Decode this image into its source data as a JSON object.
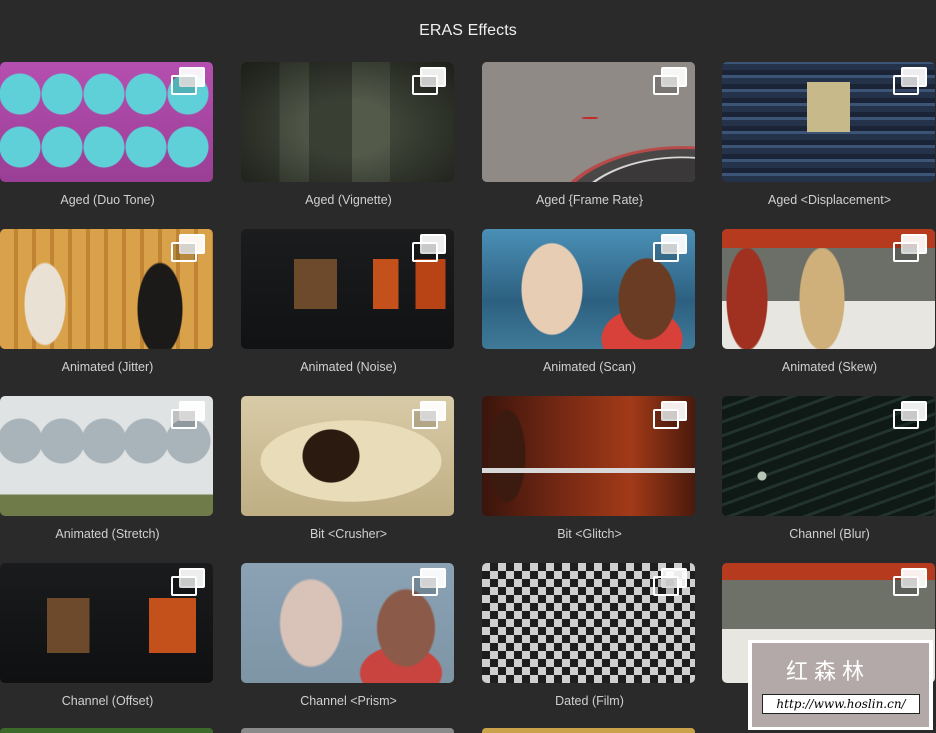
{
  "page": {
    "title": "ERAS Effects"
  },
  "effects": [
    {
      "label": "Aged (Duo Tone)",
      "icon": "overlay-preview-icon"
    },
    {
      "label": "Aged (Vignette)",
      "icon": "overlay-preview-icon"
    },
    {
      "label": "Aged {Frame Rate}",
      "icon": "overlay-preview-icon"
    },
    {
      "label": "Aged <Displacement>",
      "icon": "overlay-preview-icon"
    },
    {
      "label": "Animated (Jitter)",
      "icon": "overlay-preview-icon"
    },
    {
      "label": "Animated (Noise)",
      "icon": "overlay-preview-icon"
    },
    {
      "label": "Animated (Scan)",
      "icon": "overlay-preview-icon"
    },
    {
      "label": "Animated (Skew)",
      "icon": "overlay-preview-icon"
    },
    {
      "label": "Animated (Stretch)",
      "icon": "overlay-preview-icon"
    },
    {
      "label": "Bit <Crusher>",
      "icon": "overlay-preview-icon"
    },
    {
      "label": "Bit <Glitch>",
      "icon": "overlay-preview-icon"
    },
    {
      "label": "Channel (Blur)",
      "icon": "overlay-preview-icon"
    },
    {
      "label": "Channel (Offset)",
      "icon": "overlay-preview-icon"
    },
    {
      "label": "Channel <Prism>",
      "icon": "overlay-preview-icon"
    },
    {
      "label": "Dated (Film)",
      "icon": "overlay-preview-icon"
    },
    {
      "label": "",
      "icon": "overlay-preview-icon"
    }
  ],
  "watermark": {
    "chars": "红森林",
    "url": "http://www.hoslin.cn/"
  }
}
